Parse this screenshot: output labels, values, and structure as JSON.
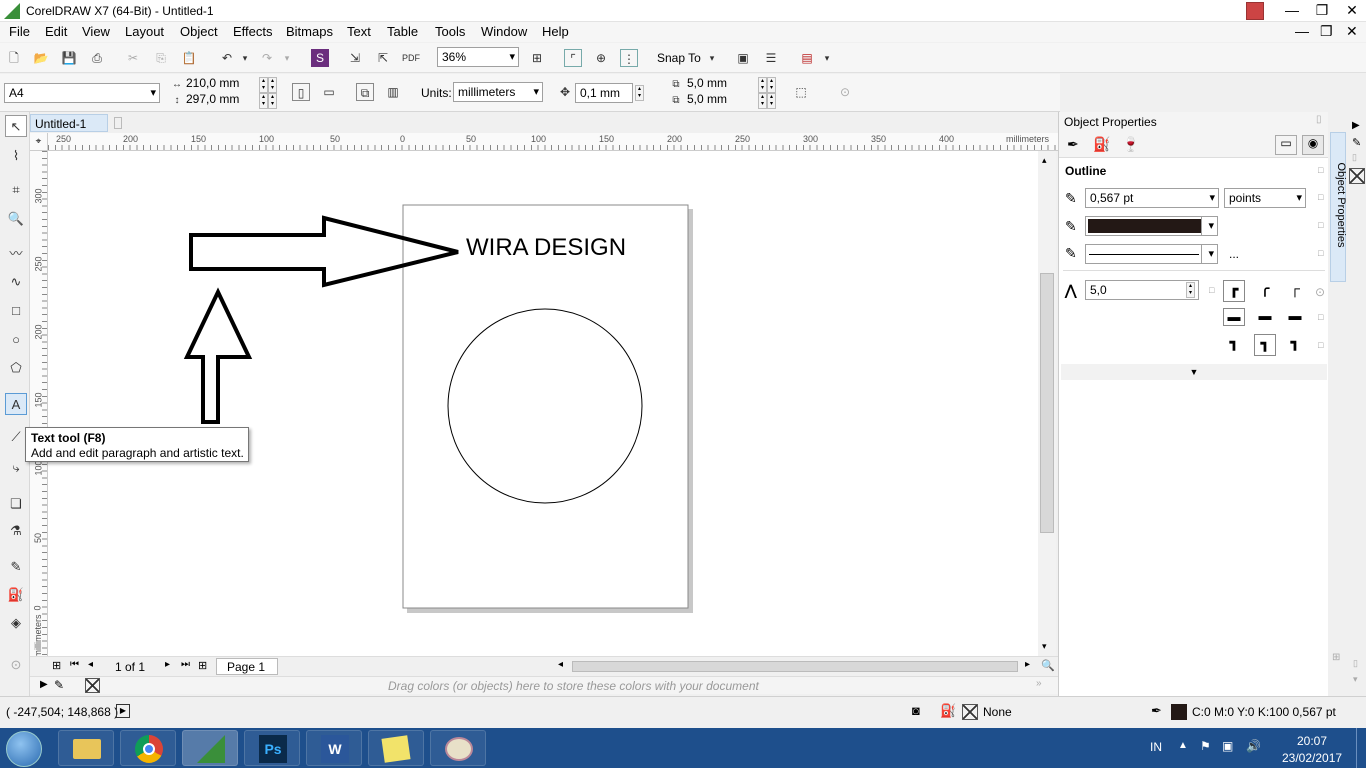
{
  "window": {
    "title": "CorelDRAW X7 (64-Bit) - Untitled-1",
    "restore_icon": "restore-icon"
  },
  "menu": [
    "File",
    "Edit",
    "View",
    "Layout",
    "Object",
    "Effects",
    "Bitmaps",
    "Text",
    "Table",
    "Tools",
    "Window",
    "Help"
  ],
  "standard_toolbar": {
    "zoom": "36%",
    "snap_to": "Snap To"
  },
  "property_bar": {
    "page_size": "A4",
    "width": "210,0 mm",
    "height": "297,0 mm",
    "units_label": "Units:",
    "units": "millimeters",
    "nudge": "0,1 mm",
    "dup_x": "5,0 mm",
    "dup_y": "5,0 mm"
  },
  "document": {
    "tab": "Untitled-1",
    "ruler_unit": "millimeters"
  },
  "ruler": {
    "h_ticks": [
      "250",
      "200",
      "150",
      "100",
      "50",
      "0",
      "50",
      "100",
      "150",
      "200",
      "250",
      "300",
      "350",
      "400"
    ],
    "v_ticks": [
      "300",
      "250",
      "200",
      "150",
      "100",
      "50",
      "0"
    ]
  },
  "canvas": {
    "text": "WIRA DESIGN"
  },
  "tooltip": {
    "title": "Text tool (F8)",
    "desc": "Add and edit paragraph and artistic text."
  },
  "page_nav": {
    "count": "1 of 1",
    "page_tab": "Page 1"
  },
  "palette": {
    "hint": "Drag colors (or objects) here to store these colors with your document"
  },
  "status": {
    "coords": "( -247,504; 148,868 )",
    "fill": "None",
    "outline": "C:0 M:0 Y:0 K:100  0,567 pt"
  },
  "docker": {
    "title": "Object Properties",
    "section": "Outline",
    "width": "0,567 pt",
    "unit": "points",
    "color": "#231815",
    "miter": "5,0",
    "more": "...",
    "side_label": "Object Properties"
  },
  "taskbar": {
    "lang": "IN",
    "time": "20:07",
    "date": "23/02/2017"
  }
}
